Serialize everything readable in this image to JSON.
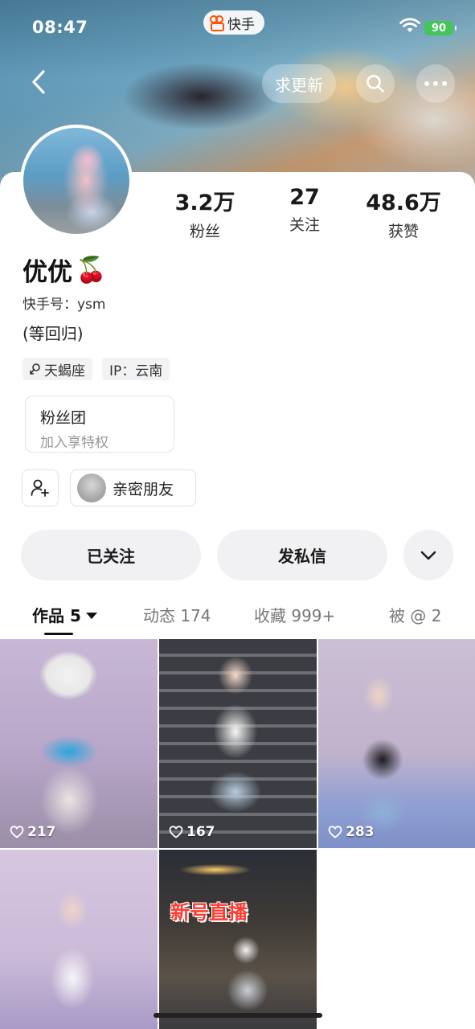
{
  "status_bar": {
    "time": "08:47",
    "app_name": "快手",
    "battery": "90"
  },
  "header": {
    "request_update_label": "求更新"
  },
  "profile": {
    "stats": [
      {
        "value": "3.2万",
        "label": "粉丝"
      },
      {
        "value": "27",
        "label": "关注"
      },
      {
        "value": "48.6万",
        "label": "获赞"
      }
    ],
    "nickname": "优优",
    "nickname_emoji": "🍒",
    "kuaishou_id": "快手号：ysm",
    "bio": "(等回归)",
    "tags": [
      "天蝎座",
      "IP：云南"
    ]
  },
  "fan_club": {
    "title": "粉丝团",
    "subtitle": "加入享特权"
  },
  "close_friends_label": "亲密朋友",
  "actions": {
    "followed_label": "已关注",
    "message_label": "发私信"
  },
  "tabs": [
    {
      "label": "作品 5"
    },
    {
      "label": "动态 174"
    },
    {
      "label": "收藏 999+"
    },
    {
      "label": "被 @ 2"
    }
  ],
  "videos": [
    {
      "likes": "217"
    },
    {
      "likes": "167"
    },
    {
      "likes": "283"
    },
    {
      "likes": ""
    },
    {
      "likes": "",
      "overlay_text": "新号直播"
    }
  ],
  "colors": {
    "brand": "#ff5000",
    "battery": "#43c55a"
  }
}
